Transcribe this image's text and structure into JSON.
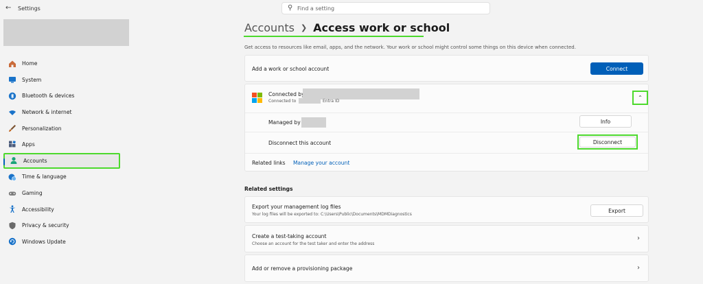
{
  "window": {
    "title": "Settings"
  },
  "search": {
    "placeholder": "Find a setting"
  },
  "sidebar": {
    "items": [
      {
        "label": "Home",
        "icon": "home-icon",
        "color": "#c96b3a"
      },
      {
        "label": "System",
        "icon": "monitor-icon",
        "color": "#1a73c9"
      },
      {
        "label": "Bluetooth & devices",
        "icon": "bluetooth-icon",
        "color": "#1a73c9"
      },
      {
        "label": "Network & internet",
        "icon": "wifi-icon",
        "color": "#1a73c9"
      },
      {
        "label": "Personalization",
        "icon": "brush-icon",
        "color": "#c0651e"
      },
      {
        "label": "Apps",
        "icon": "apps-icon",
        "color": "#4a5a7a"
      },
      {
        "label": "Accounts",
        "icon": "person-icon",
        "color": "#1aa37a"
      },
      {
        "label": "Time & language",
        "icon": "globe-clock-icon",
        "color": "#1a73c9"
      },
      {
        "label": "Gaming",
        "icon": "gamepad-icon",
        "color": "#7a7a7a"
      },
      {
        "label": "Accessibility",
        "icon": "accessibility-icon",
        "color": "#1a73c9"
      },
      {
        "label": "Privacy & security",
        "icon": "shield-icon",
        "color": "#6a6a6a"
      },
      {
        "label": "Windows Update",
        "icon": "update-icon",
        "color": "#1a73c9"
      }
    ],
    "active_index": 6
  },
  "breadcrumb": {
    "parent": "Accounts",
    "current": "Access work or school"
  },
  "description": "Get access to resources like email, apps, and the network. Your work or school might control some things on this device when connected.",
  "add_account": {
    "label": "Add a work or school account",
    "button": "Connect"
  },
  "connection": {
    "title": "Connected by",
    "subtitle_prefix": "Connected to",
    "subtitle_suffix": "Entra ID",
    "managed_by_label": "Managed by",
    "info_button": "Info",
    "disconnect_label": "Disconnect this account",
    "disconnect_button": "Disconnect",
    "related_links_label": "Related links",
    "manage_link": "Manage your account"
  },
  "related_settings": {
    "heading": "Related settings",
    "export": {
      "title": "Export your management log files",
      "subtitle": "Your log files will be exported to: C:\\Users\\Public\\Documents\\MDMDiagnostics",
      "button": "Export"
    },
    "test_account": {
      "title": "Create a test-taking account",
      "subtitle": "Choose an account for the test taker and enter the address"
    },
    "provisioning": {
      "title": "Add or remove a provisioning package"
    }
  },
  "colors": {
    "accent": "#005fb8",
    "highlight": "#4cd92c"
  }
}
